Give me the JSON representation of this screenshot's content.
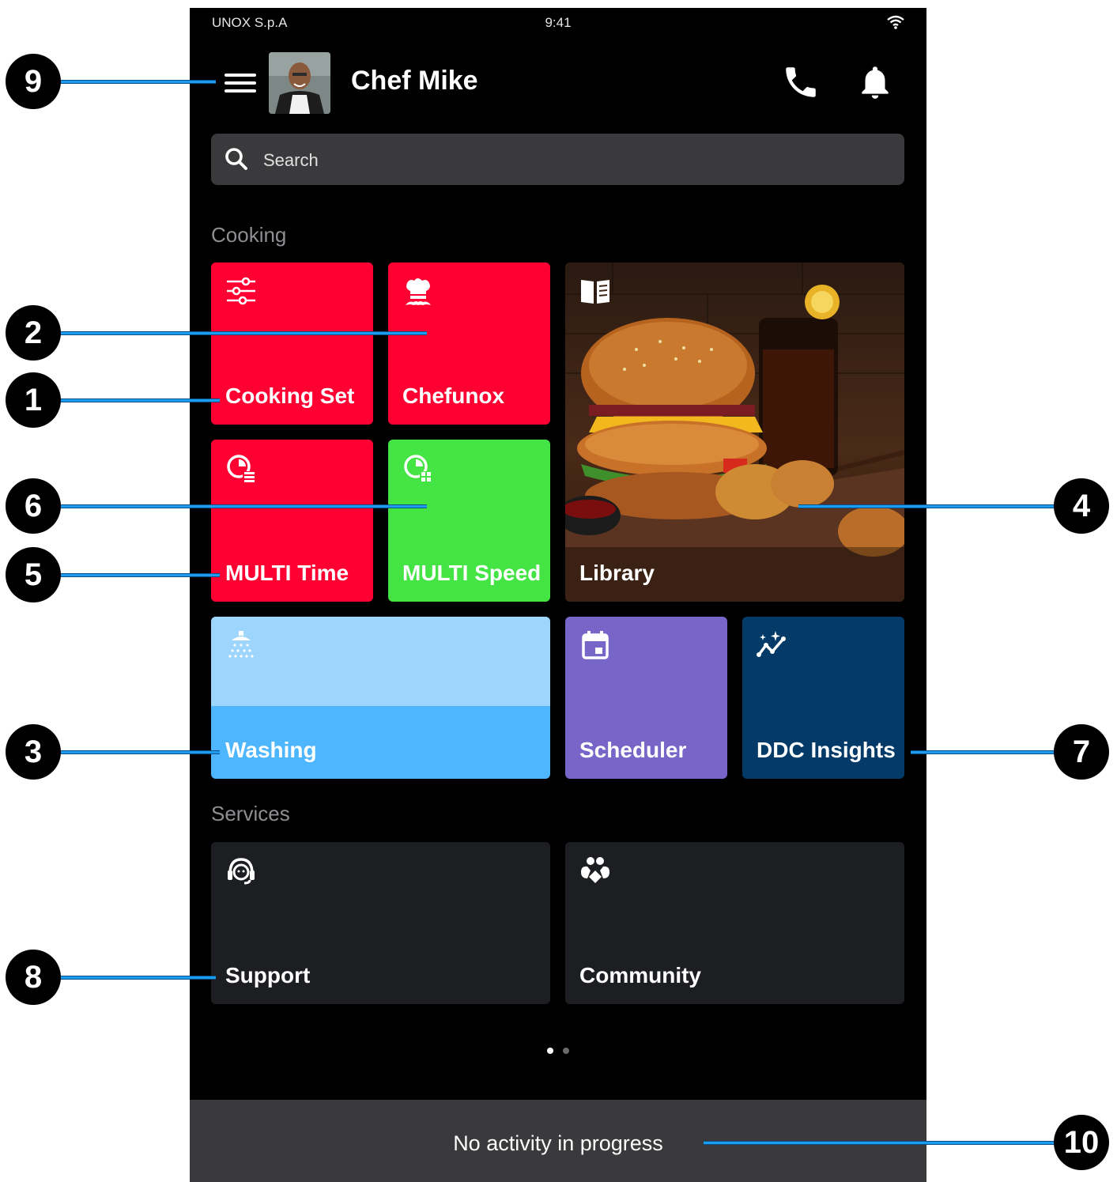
{
  "status_bar": {
    "carrier": "UNOX S.p.A",
    "time": "9:41"
  },
  "header": {
    "user_name": "Chef Mike"
  },
  "search": {
    "placeholder": "Search"
  },
  "sections": {
    "cooking": "Cooking",
    "services": "Services"
  },
  "tiles": {
    "cooking_set": {
      "label": "Cooking Set",
      "icon": "sliders-icon",
      "color": "#ff0032"
    },
    "chefunox": {
      "label": "Chefunox",
      "icon": "chef-hat-icon",
      "color": "#ff0032"
    },
    "library": {
      "label": "Library",
      "icon": "book-icon"
    },
    "multi_time": {
      "label": "MULTI Time",
      "icon": "multi-time-icon",
      "color": "#ff0032"
    },
    "multi_speed": {
      "label": "MULTI Speed",
      "icon": "multi-speed-icon",
      "color": "#44e444"
    },
    "washing": {
      "label": "Washing",
      "icon": "shower-icon",
      "color": "#4db6ff"
    },
    "scheduler": {
      "label": "Scheduler",
      "icon": "calendar-icon",
      "color": "#7765c7"
    },
    "ddc_insights": {
      "label": "DDC Insights",
      "icon": "insights-icon",
      "color": "#033a68"
    },
    "support": {
      "label": "Support",
      "icon": "support-agent-icon",
      "color": "#1c1e22"
    },
    "community": {
      "label": "Community",
      "icon": "community-icon",
      "color": "#1c1e22"
    }
  },
  "activity_bar": {
    "text": "No activity in progress"
  },
  "callouts": [
    "1",
    "2",
    "3",
    "4",
    "5",
    "6",
    "7",
    "8",
    "9",
    "10"
  ],
  "colors": {
    "callout_line": "#1a9cf0",
    "background": "#000000",
    "search_bg": "#3a3a3c"
  }
}
